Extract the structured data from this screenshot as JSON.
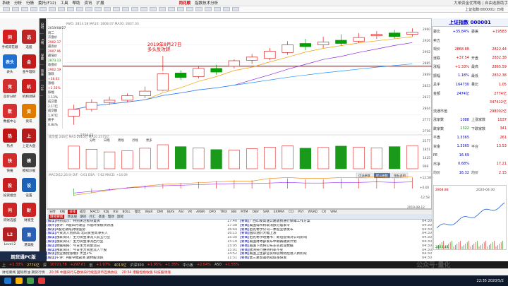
{
  "menu": {
    "items": [
      "系统",
      "分析",
      "行情",
      "委托(F12)",
      "工具",
      "帮助",
      "资讯",
      "扩展"
    ],
    "brand": "同花顺",
    "subtitle": "指数技术分析",
    "right": "大单资金优策略 | 自由选股助手"
  },
  "toolbar": {
    "label": "上证指数(000001) 日线"
  },
  "left_tabs": [
    "应用",
    "我的",
    "资讯"
  ],
  "left_apps": [
    {
      "label": "手机同花顺",
      "icon": "同",
      "color": "#d42020"
    },
    {
      "label": "选股",
      "icon": "选",
      "color": "#c02525"
    },
    {
      "label": "表头",
      "icon": "表头",
      "color": "#1f6fd1"
    },
    {
      "label": "金牛理财",
      "icon": "金",
      "color": "#c21b1b"
    },
    {
      "label": "竞价分析",
      "icon": "竞",
      "color": "#d23030"
    },
    {
      "label": "机构调研",
      "icon": "机",
      "color": "#cc2020"
    },
    {
      "label": "数据中心",
      "icon": "数",
      "color": "#d63030"
    },
    {
      "label": "资讯",
      "icon": "资",
      "color": "#e07b00"
    },
    {
      "label": "热点",
      "icon": "热",
      "color": "#c01818"
    },
    {
      "label": "上证大盘",
      "icon": "上",
      "color": "#b71c1c"
    },
    {
      "label": "快报",
      "icon": "快",
      "color": "#d32b2b"
    },
    {
      "label": "模拟炒股",
      "icon": "模",
      "color": "#3b3b3b"
    },
    {
      "label": "投资组合",
      "icon": "投",
      "color": "#c62020"
    },
    {
      "label": "设置",
      "icon": "设",
      "color": "#1a62b8"
    },
    {
      "label": "问财选股",
      "icon": "问",
      "color": "#cd2525"
    },
    {
      "label": "财富宝",
      "icon": "财",
      "color": "#cc2222"
    },
    {
      "label": "Level-2",
      "icon": "L2",
      "color": "#b22222"
    },
    {
      "label": "港美股",
      "icon": "港",
      "color": "#2b5fb3"
    }
  ],
  "left_strip": [
    "分时",
    "K线",
    "深度",
    "资金",
    "F10"
  ],
  "info": {
    "date": "2019/08/27",
    "week": "周二",
    "open_label": "开盘价",
    "open": "2902.17",
    "high_label": "最高价",
    "high": "2907.96",
    "low_label": "最低价",
    "low": "2873.13",
    "close_label": "收盘价",
    "close": "2902.19",
    "change_label": "涨跌",
    "change": "+38.63",
    "pct_label": "涨幅",
    "pct": "+1.35%",
    "amp_label": "振幅",
    "amp": "1.13%",
    "vol_label": "成交量",
    "vol": "2.17亿",
    "amt_label": "成交额",
    "amt": "1.97亿",
    "turn_label": "换手",
    "turn": "0.84%"
  },
  "annotation": "2019年8月27日\n多头反攻转",
  "low_annotation": "2756.63",
  "indicator_tabs": {
    "ma_line": "MA5: 2814.58  MA10: 2808.07  MA30: 2837.33",
    "vol_label": "成交量 246亿  MA5 2610亿  MA10 2575亿",
    "macd_label": "MACD(12,26,9) DIF: -0.61 DEA: -7.62 MACD: +14.09",
    "panel_tabs": [
      "分时",
      "日线",
      "周线",
      "月线",
      "更多"
    ],
    "vol_side_tabs": [
      "资金流向",
      "成交",
      "成交明细",
      "历史成交",
      "分时成交"
    ],
    "macd_side_tabs": [
      "优选参数",
      "默认参数",
      "指标说明"
    ],
    "axis_labels": [
      "2960",
      "2926",
      "2902",
      "2885",
      "2869",
      "2853",
      "2837",
      "2804",
      "2777",
      "2756"
    ],
    "vol_axis_labels": [
      "2277",
      "1851",
      "1425",
      "999"
    ],
    "macd_axis_labels": [
      "+12.58",
      "+0.00",
      "-12.58"
    ],
    "bottom_date": "2019-08-12"
  },
  "chart_tabs": [
    "分时",
    "K线",
    "日线",
    "成交",
    "MACD",
    "KDJ",
    "RSI",
    "BOLL",
    "量比",
    "W&R",
    "DMI",
    "BIAS",
    "ASI",
    "VR",
    "ARBR",
    "DPO",
    "TRIX",
    "BBI",
    "MTM",
    "OBV",
    "SAR",
    "EXPMA",
    "CCI",
    "PSY",
    "WVAD",
    "CR",
    "VMA"
  ],
  "chart_data": {
    "type": "candlestick",
    "candles": [
      {
        "open": 2775,
        "close": 2790,
        "high": 2800,
        "low": 2756
      },
      {
        "open": 2790,
        "close": 2805,
        "high": 2812,
        "low": 2785
      },
      {
        "open": 2805,
        "close": 2810,
        "high": 2818,
        "low": 2800
      },
      {
        "open": 2810,
        "close": 2820,
        "high": 2825,
        "low": 2805
      },
      {
        "open": 2820,
        "close": 2830,
        "high": 2840,
        "low": 2815
      },
      {
        "open": 2832,
        "close": 2868,
        "high": 2870,
        "low": 2830
      },
      {
        "open": 2870,
        "close": 2860,
        "high": 2876,
        "low": 2855
      },
      {
        "open": 2862,
        "close": 2880,
        "high": 2885,
        "low": 2858
      },
      {
        "open": 2880,
        "close": 2872,
        "high": 2888,
        "low": 2866
      },
      {
        "open": 2885,
        "close": 2897,
        "high": 2900,
        "low": 2880
      },
      {
        "open": 2898,
        "close": 2905,
        "high": 2912,
        "low": 2890
      },
      {
        "open": 2902,
        "close": 2918,
        "high": 2925,
        "low": 2898
      },
      {
        "open": 2915,
        "close": 2932,
        "high": 2940,
        "low": 2910
      },
      {
        "open": 2935,
        "close": 2928,
        "high": 2945,
        "low": 2920
      },
      {
        "open": 2932,
        "close": 2938,
        "high": 2950,
        "low": 2925
      },
      {
        "open": 2942,
        "close": 2935,
        "high": 2955,
        "low": 2930
      },
      {
        "open": 2940,
        "close": 2948,
        "high": 2958,
        "low": 2936
      },
      {
        "open": 2952,
        "close": 2955,
        "high": 2962,
        "low": 2945
      },
      {
        "open": 2958,
        "close": 2950,
        "high": 2965,
        "low": 2946
      },
      {
        "open": 2955,
        "close": 2960,
        "high": 2968,
        "low": 2950
      }
    ],
    "volumes": [
      2150,
      1850,
      1600,
      1700,
      1950,
      2277,
      2100,
      1980,
      1820,
      1760,
      1900,
      2050,
      2180,
      1950,
      2020,
      2150,
      2060,
      1980,
      2100,
      2200
    ],
    "macd": [
      -8,
      -5,
      -2,
      1,
      3,
      5,
      6,
      7,
      8,
      9,
      9,
      10,
      11,
      10,
      10,
      11,
      11,
      12,
      11,
      12
    ],
    "ylim": [
      2740,
      2970
    ]
  },
  "quote": {
    "title": "上证指数 000001",
    "rows": [
      {
        "k": "委比",
        "v": "+35.84%",
        "k2": "委差",
        "v2": "+19583"
      },
      {
        "k": "卖五",
        "v": "",
        "k2": "",
        "v2": ""
      },
      {
        "k": "现价",
        "v": "2868.88",
        "k2": "",
        "v2": "2822.44"
      },
      {
        "k": "涨跌",
        "v": "+37.54",
        "k2": "开盘",
        "v2": "2832.38"
      },
      {
        "k": "涨幅",
        "v": "+1.33%",
        "k2": "最高",
        "v2": "2865.59"
      },
      {
        "k": "振幅",
        "v": "1.18%",
        "k2": "最低",
        "v2": "2832.38"
      },
      {
        "k": "总手",
        "v": "164730",
        "k2": "量比",
        "v2": "1.05"
      },
      {
        "k": "金额",
        "v": "2474亿",
        "k2": "",
        "v2": "2774亿"
      },
      {
        "k": "",
        "v": "",
        "k2": "",
        "v2": "347412亿"
      },
      {
        "k": "流通市值",
        "v": "",
        "k2": "",
        "v2": "298002亿"
      },
      {
        "k": "涨家数",
        "v": "1088",
        "k2": "上涨家数",
        "v2": "1037"
      },
      {
        "k": "跌家数",
        "v": "1322",
        "k2": "下跌家数",
        "v2": "341"
      },
      {
        "k": "平盘",
        "v": "1.3365",
        "k2": "",
        "v2": "261"
      },
      {
        "k": "资金",
        "v": "1.3365",
        "k2": "平台",
        "v2": "13.53"
      },
      {
        "k": "PE",
        "v": "16.69",
        "k2": "",
        "v2": ""
      },
      {
        "k": "市净",
        "v": "0.68%",
        "k2": "",
        "v2": "17.21"
      },
      {
        "k": "均价",
        "v": "16.32",
        "k2": "均价",
        "v2": "2.15"
      }
    ],
    "mini_axis": [
      "2868.88",
      "2822.44"
    ],
    "mini_date": "2020-04-30"
  },
  "news_tabs": [
    "财经要闻",
    "港美股",
    "期货",
    "外汇",
    "基金",
    "理财",
    "国际"
  ],
  "news_left": [
    {
      "tag": "[解读]",
      "text": "特别提示：特别关注板块复牌",
      "time": "17:40"
    },
    {
      "tag": "[收评]",
      "text": "收评：A股四月收官 节能环保板块领涨",
      "time": "17:38"
    },
    {
      "tag": "[解读]",
      "text": "A股近期或持续强势",
      "time": "16:44"
    },
    {
      "tag": "[解读]",
      "text": "外资流入创新高 北向资金周净买入",
      "time": "16:15"
    },
    {
      "tag": "[解读]",
      "text": "独家资讯：主力资金净流入前五行业",
      "time": "15:30"
    },
    {
      "tag": "[解读]",
      "text": "独家资讯：主力资金净流出行业",
      "time": "15:10"
    },
    {
      "tag": "[解读]",
      "text": "数据揭秘：今日主力资金流向",
      "time": "15:05"
    },
    {
      "tag": "[解读]",
      "text": "独家资讯：今日主力资金流入个股",
      "time": "15:01"
    },
    {
      "tag": "[解读]",
      "text": "创业板指涨幅扩大至2%",
      "time": "14:52"
    },
    {
      "tag": "[解读]",
      "text": "午评：A股窄幅震荡 题材股活跃",
      "time": "11:31"
    }
  ],
  "news_right": [
    {
      "tag": "[要闻]",
      "text": "广西印发高速公路收费通行保障工作方案",
      "time": "04:30"
    },
    {
      "tag": "[要闻]",
      "text": "美国得州将取消部分居家令",
      "time": "04:30"
    },
    {
      "tag": "[要闻]",
      "text": "伯克希尔公司一季度业绩发布",
      "time": "04:30"
    },
    {
      "tag": "[要闻]",
      "text": "国际油价大幅上涨",
      "time": "04:30"
    },
    {
      "tag": "[要闻]",
      "text": "伯克希尔哈撒韦：新冠疫情对公司影响",
      "time": "04:30"
    },
    {
      "tag": "[要闻]",
      "text": "美国财政部发布中期再融资计划",
      "time": "04:30"
    },
    {
      "tag": "[要闻]",
      "text": "美国下周将公布非农就业数据",
      "time": "04:30"
    },
    {
      "tag": "[要闻]",
      "text": "欧洲央行维持利率不变",
      "time": "04:30"
    },
    {
      "tag": "[要闻]",
      "text": "美国卫生部官员称疫情防控进入新阶段",
      "time": "04:30"
    },
    {
      "tag": "[要闻]",
      "text": "晋三星加速新冠疫苗研发",
      "time": "04:30"
    }
  ],
  "pc_label": "期货通PC版",
  "status_items": [
    {
      "text": "上",
      "cls": ""
    },
    {
      "text": "+1.33%",
      "cls": "r"
    },
    {
      "text": "2774亿",
      "cls": "y"
    },
    {
      "text": "深",
      "cls": ""
    },
    {
      "text": "10721.78",
      "cls": "r"
    },
    {
      "text": "+297.61",
      "cls": "r"
    },
    {
      "text": "创",
      "cls": ""
    },
    {
      "text": "+1.97%",
      "cls": "r"
    },
    {
      "text": "4013亿",
      "cls": "y"
    },
    {
      "text": "沪深300",
      "cls": ""
    },
    {
      "text": "+1.95%",
      "cls": "r"
    },
    {
      "text": "+1.35%",
      "cls": "r"
    },
    {
      "text": "中小板",
      "cls": ""
    },
    {
      "text": "+2.04%",
      "cls": "r"
    },
    {
      "text": "A50",
      "cls": ""
    },
    {
      "text": "+1.55%",
      "cls": "r"
    }
  ],
  "ticker_items": [
    "财经要闻 国际原油 期货行情",
    "20:36 中国央行与欧洲央行续签货币互换协议",
    "20:34 港股恒指收涨 科技股领涨"
  ],
  "taskbar": {
    "clock": "22:35\n2020/5/2"
  },
  "watermark": "公众号·量化"
}
